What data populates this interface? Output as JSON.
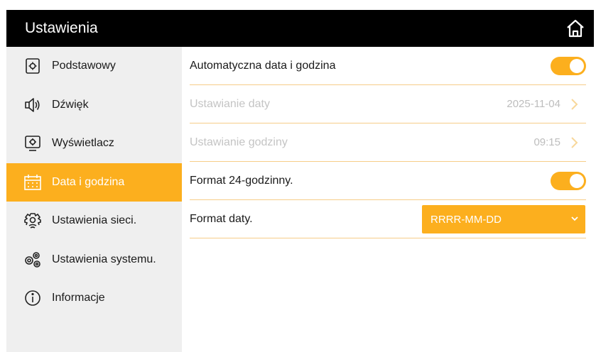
{
  "header": {
    "title": "Ustawienia",
    "home_icon": "home-icon"
  },
  "sidebar": {
    "items": [
      {
        "label": "Podstawowy",
        "icon": "basic-settings-icon",
        "active": false
      },
      {
        "label": "Dźwięk",
        "icon": "speaker-icon",
        "active": false
      },
      {
        "label": "Wyświetlacz",
        "icon": "display-icon",
        "active": false
      },
      {
        "label": "Data i godzina",
        "icon": "calendar-icon",
        "active": true
      },
      {
        "label": "Ustawienia sieci.",
        "icon": "network-gear-icon",
        "active": false
      },
      {
        "label": "Ustawienia systemu.",
        "icon": "system-gears-icon",
        "active": false
      },
      {
        "label": "Informacje",
        "icon": "info-icon",
        "active": false
      }
    ]
  },
  "main": {
    "auto_datetime": {
      "label": "Automatyczna data i godzina",
      "enabled": true
    },
    "date_setting": {
      "label": "Ustawianie daty",
      "value": "2025-11-04"
    },
    "time_setting": {
      "label": "Ustawianie godziny",
      "value": "09:15"
    },
    "format_24h": {
      "label": "Format 24-godzinny.",
      "enabled": true
    },
    "date_format": {
      "label": "Format daty.",
      "selected": "RRRR-MM-DD"
    }
  },
  "colors": {
    "accent": "#fcaf1e",
    "header_bg": "#000000",
    "sidebar_bg": "#efefef",
    "divider": "#f6cd88",
    "disabled_text": "#c4c4c4"
  }
}
